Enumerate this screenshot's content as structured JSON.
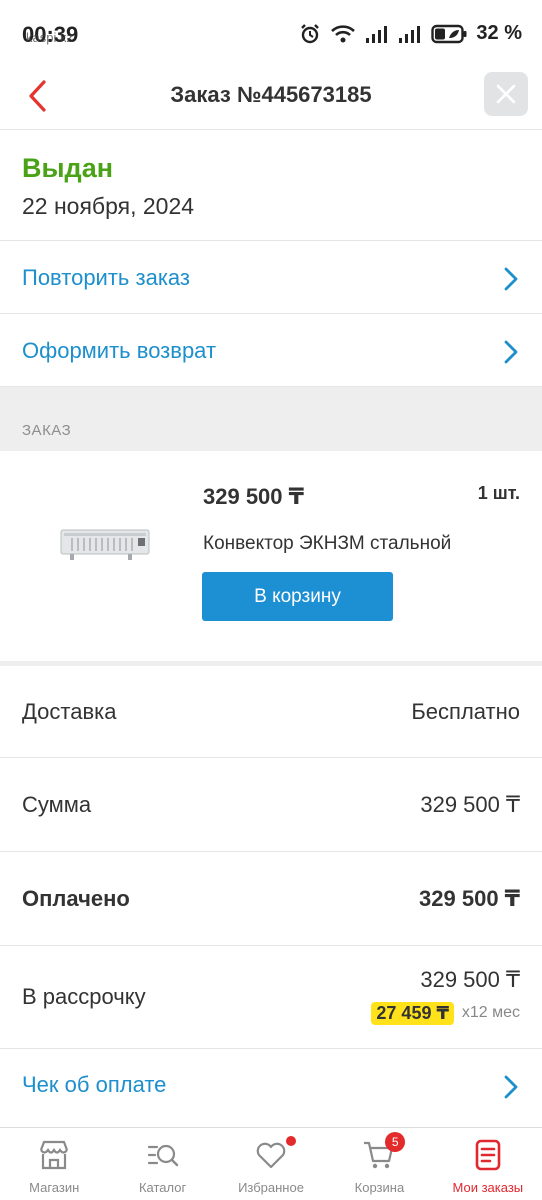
{
  "status_bar": {
    "time": "00:39",
    "overlay_text": "kaspi.kz",
    "battery": "32 %"
  },
  "header": {
    "title": "Заказ №445673185"
  },
  "order": {
    "status": "Выдан",
    "date": "22 ноября, 2024"
  },
  "actions": {
    "repeat": "Повторить заказ",
    "return": "Оформить возврат"
  },
  "section": {
    "order_label": "ЗАКАЗ"
  },
  "product": {
    "price": "329 500 ₸",
    "qty": "1 шт.",
    "name": "Конвектор ЭКНЗМ стальной",
    "cart_button": "В корзину"
  },
  "summary": {
    "delivery_label": "Доставка",
    "delivery_value": "Бесплатно",
    "sum_label": "Сумма",
    "sum_value": "329 500 ₸",
    "paid_label": "Оплачено",
    "paid_value": "329 500 ₸",
    "installment_label": "В рассрочку",
    "installment_value": "329 500 ₸",
    "installment_monthly": "27 459 ₸",
    "installment_term": "x12 мес"
  },
  "receipt": {
    "label": "Чек об оплате"
  },
  "bottom_nav": {
    "items": [
      {
        "label": "Магазин",
        "icon": "shop-icon"
      },
      {
        "label": "Каталог",
        "icon": "catalog-search-icon"
      },
      {
        "label": "Избранное",
        "icon": "heart-icon"
      },
      {
        "label": "Корзина",
        "icon": "cart-icon",
        "badge": "5"
      },
      {
        "label": "Мои заказы",
        "icon": "orders-icon"
      }
    ]
  },
  "colors": {
    "accent_blue": "#1d8fd3",
    "status_green": "#4aa217",
    "nav_active": "#e0282f",
    "highlight_yellow": "#ffe21a"
  }
}
